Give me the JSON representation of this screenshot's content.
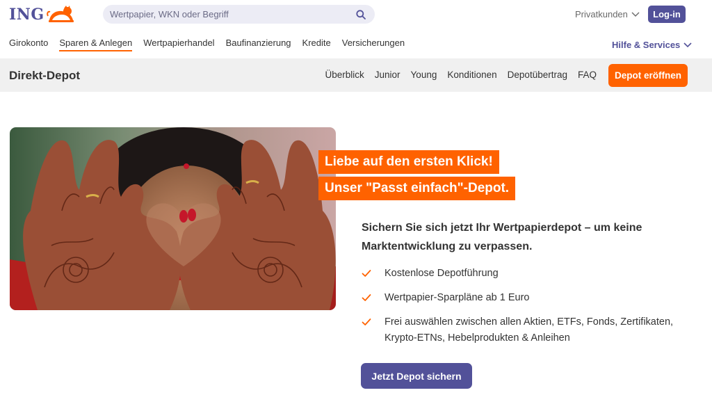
{
  "brand": {
    "name": "ING",
    "accent": "#ff6200",
    "primary": "#525199"
  },
  "header": {
    "search_placeholder": "Wertpapier, WKN oder Begriff",
    "segment": "Privatkunden",
    "login": "Log-in"
  },
  "mainnav": {
    "items": [
      {
        "label": "Girokonto"
      },
      {
        "label": "Sparen & Anlegen",
        "active": true
      },
      {
        "label": "Wertpapierhandel"
      },
      {
        "label": "Baufinanzierung"
      },
      {
        "label": "Kredite"
      },
      {
        "label": "Versicherungen"
      }
    ],
    "help": "Hilfe & Services"
  },
  "subbar": {
    "title": "Direkt-Depot",
    "links": [
      "Überblick",
      "Junior",
      "Young",
      "Konditionen",
      "Depotübertrag",
      "FAQ"
    ],
    "cta": "Depot eröffnen"
  },
  "hero": {
    "headline1": "Liebe auf den ersten Klick!",
    "headline2": "Unser \"Passt einfach\"-Depot.",
    "lead": "Sichern Sie sich jetzt Ihr Wertpapierdepot – um keine Marktentwicklung zu verpassen.",
    "features": [
      "Kostenlose Depotführung",
      "Wertpapier-Sparpläne ab 1 Euro",
      "Frei auswählen zwischen allen Aktien, ETFs, Fonds, Zertifikaten, Krypto-ETNs, Hebelprodukten & Anleihen"
    ],
    "cta": "Jetzt Depot sichern"
  }
}
